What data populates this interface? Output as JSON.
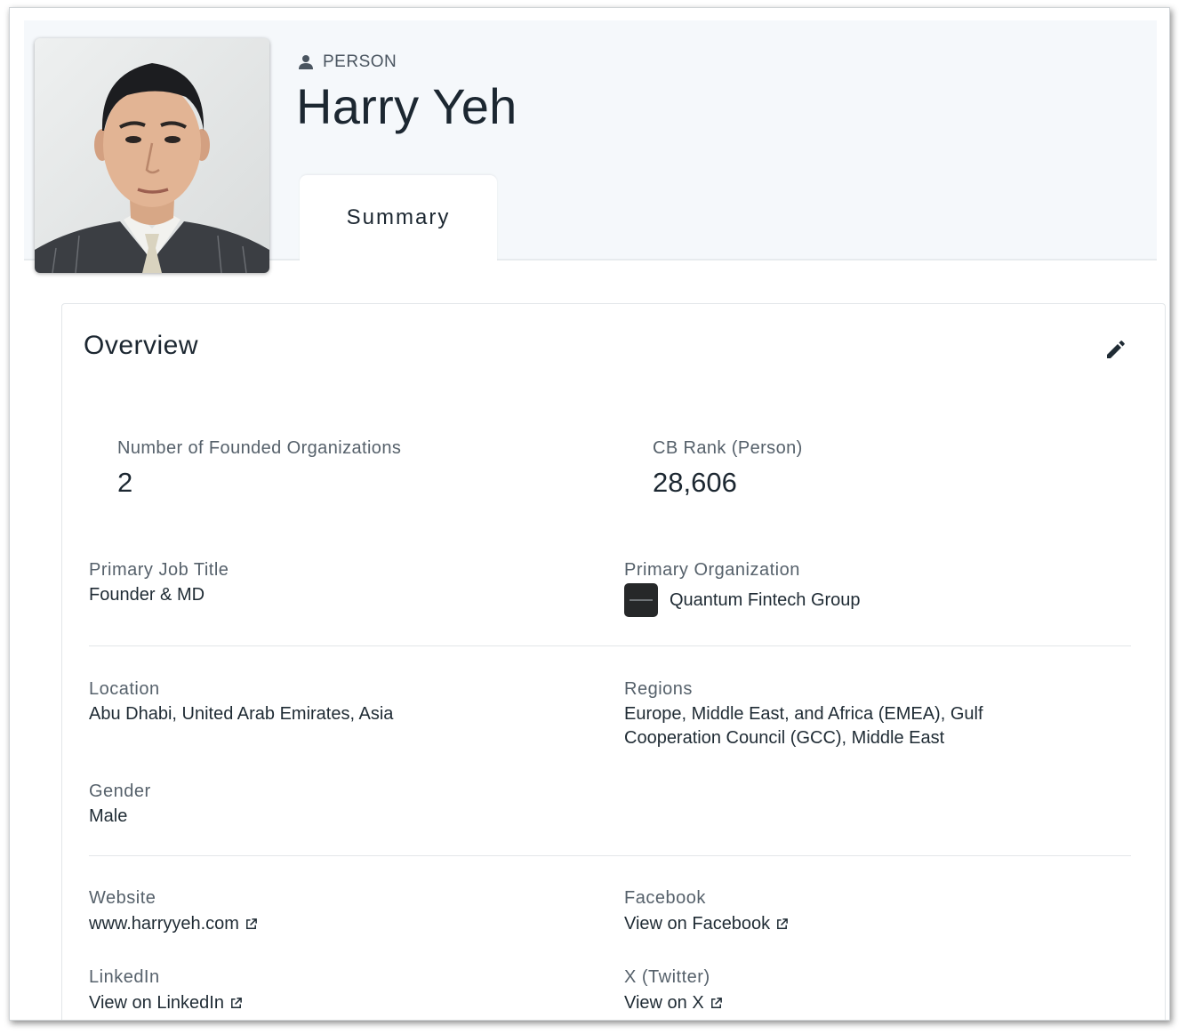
{
  "header": {
    "entity_type": "PERSON",
    "name": "Harry Yeh",
    "tab_label": "Summary"
  },
  "overview": {
    "title": "Overview",
    "stats": [
      {
        "label": "Number of Founded Organizations",
        "value": "2"
      },
      {
        "label": "CB Rank (Person)",
        "value": "28,606"
      }
    ],
    "primary_job_title": {
      "label": "Primary Job Title",
      "value": "Founder & MD"
    },
    "primary_organization": {
      "label": "Primary Organization",
      "value": "Quantum Fintech Group"
    },
    "location": {
      "label": "Location",
      "value": "Abu Dhabi, United Arab Emirates, Asia"
    },
    "regions": {
      "label": "Regions",
      "line1": "Europe, Middle East, and Africa (EMEA), Gulf",
      "line2": "Cooperation Council (GCC), Middle East"
    },
    "gender": {
      "label": "Gender",
      "value": "Male"
    },
    "website": {
      "label": "Website",
      "value": "www.harryyeh.com"
    },
    "facebook": {
      "label": "Facebook",
      "value": "View on Facebook"
    },
    "linkedin": {
      "label": "LinkedIn",
      "value": "View on LinkedIn"
    },
    "twitter": {
      "label": "X (Twitter)",
      "value": "View on X"
    }
  },
  "icons": {
    "entity_type": "person-icon",
    "edit": "pencil-icon",
    "external_link": "external-link-icon"
  },
  "colors": {
    "header_bg": "#f5f8fb",
    "text_primary": "#1c2731",
    "text_secondary": "#56616b"
  }
}
